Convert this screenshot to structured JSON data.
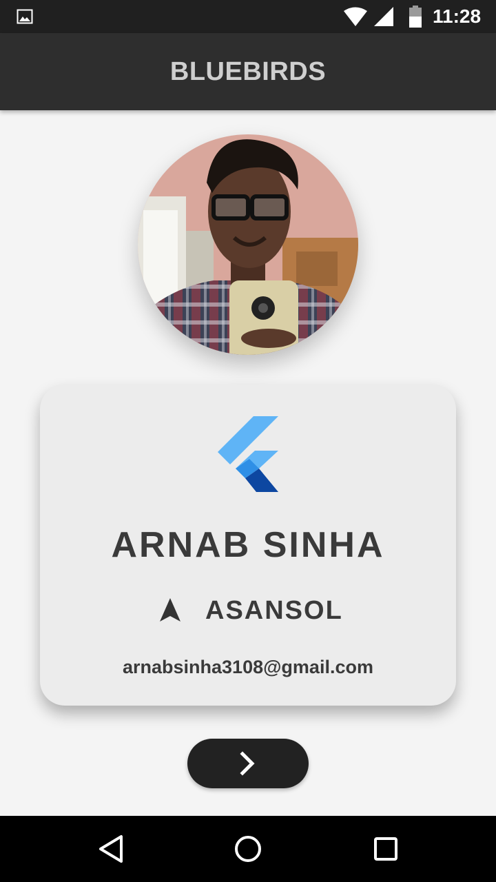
{
  "status_bar": {
    "time": "11:28",
    "icons": [
      "gallery-notification-icon",
      "wifi-icon",
      "cell-signal-icon",
      "battery-icon"
    ]
  },
  "app_bar": {
    "title": "BLUEBIRDS"
  },
  "profile": {
    "avatar_icon": "profile-photo",
    "logo_icon": "flutter-logo",
    "name": "ARNAB SINHA",
    "location_icon": "navigation-arrow-icon",
    "location": "ASANSOL",
    "email": "arnabsinha3108@gmail.com"
  },
  "next_button": {
    "icon": "chevron-right-icon"
  },
  "nav_bar": {
    "icons": [
      "back-icon",
      "home-icon",
      "recents-icon"
    ]
  },
  "colors": {
    "background": "#f4f4f4",
    "app_bar": "#2e2e2e",
    "status_bar": "#202020",
    "card": "#ececec",
    "text": "#3a3a3a",
    "button": "#222222",
    "flutter_light": "#5fb4f6",
    "flutter_dark": "#0d47a1"
  }
}
